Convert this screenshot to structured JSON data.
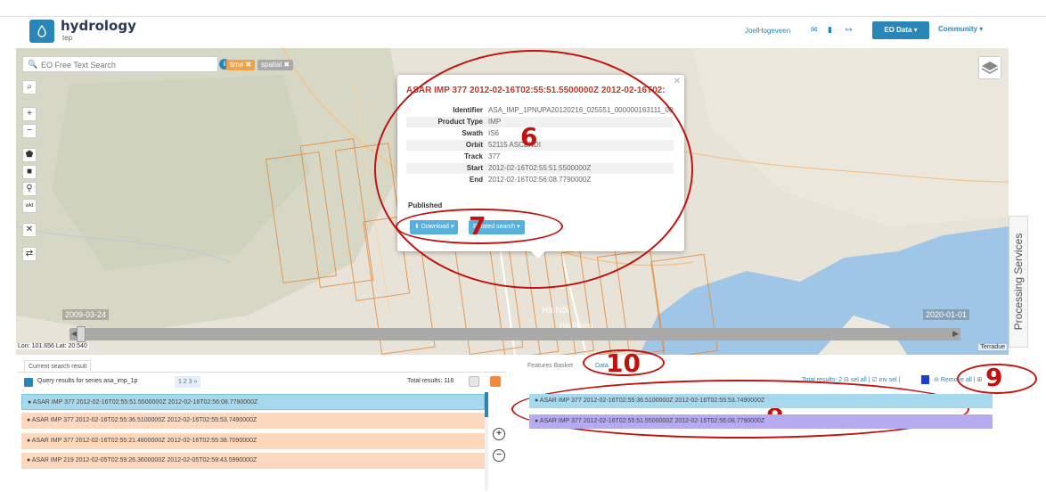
{
  "header": {
    "app_name": "hydrology",
    "app_sub": "tep",
    "user": "JoelHogeveen",
    "eo_button": "EO Data ▾",
    "community": "Community ▾"
  },
  "map": {
    "search_placeholder": "EO Free Text Search",
    "tags": {
      "time": "time ✖",
      "spatial": "spatial ✖"
    },
    "date_start": "2009-03-24",
    "date_end": "2020-01-01",
    "latlon": "Lon: 101.656 Lat: 20.540",
    "attribution": "Terradue",
    "processing_tab": "Processing Services",
    "places": {
      "hanoi": "Hà Nội",
      "haiphong": "Hải Phòng"
    }
  },
  "popup": {
    "title": "ASAR IMP 377 2012-02-16T02:55:51.5500000Z 2012-02-16T02:",
    "rows": [
      {
        "key": "Identifier",
        "value": "ASA_IMP_1PNUPA20120216_025551_000000163111_002"
      },
      {
        "key": "Product Type",
        "value": "IMP"
      },
      {
        "key": "Swath",
        "value": "IS6"
      },
      {
        "key": "Orbit",
        "value": "52115 ASCENDI"
      },
      {
        "key": "Track",
        "value": "377"
      },
      {
        "key": "Start",
        "value": "2012-02-16T02:55:51.5500000Z"
      },
      {
        "key": "End",
        "value": "2012-02-16T02:56:08.7790000Z"
      }
    ],
    "published": "Published",
    "download": "⬇ Download ▾",
    "related": "Related search ▾"
  },
  "results": {
    "tab": "Current search result",
    "query": "Query results for series asa_imp_1p",
    "pages": "1  2  3  »",
    "total": "Total results: 116",
    "rows": [
      "ASAR IMP 377 2012-02-16T02:55:51.5500000Z 2012-02-16T02:56:08.7790000Z",
      "ASAR IMP 377 2012-02-16T02:55:36.5100000Z 2012-02-16T02:55:53.7490000Z",
      "ASAR IMP 377 2012-02-16T02:55:21.4800000Z 2012-02-16T02:55:38.7090000Z",
      "ASAR IMP 219 2012-02-05T02:59:26.3600000Z 2012-02-05T02:59:43.5990000Z"
    ]
  },
  "basket": {
    "tab_features": "Features Basket",
    "tab_data": "Data",
    "tools": "Total results: 2   ⊟ sel all | ☑ inv sel |",
    "remove": "⊖ Remove all | ⊞",
    "rows": [
      "ASAR IMP 377 2012-02-16T02:55:36.5100000Z 2012-02-16T02:55:53.7490000Z",
      "ASAR IMP 377 2012-02-16T02:55:51.5500000Z 2012-02-16T02:56:08.7790000Z"
    ]
  },
  "annotations": [
    "6",
    "7",
    "8",
    "9",
    "10"
  ],
  "colors": {
    "accent": "#2a86b8",
    "annotation": "#c0130e",
    "selected_row": "#a7d9ee",
    "result_row": "#fcd8bf",
    "basket_row_2": "#b7abf0"
  }
}
